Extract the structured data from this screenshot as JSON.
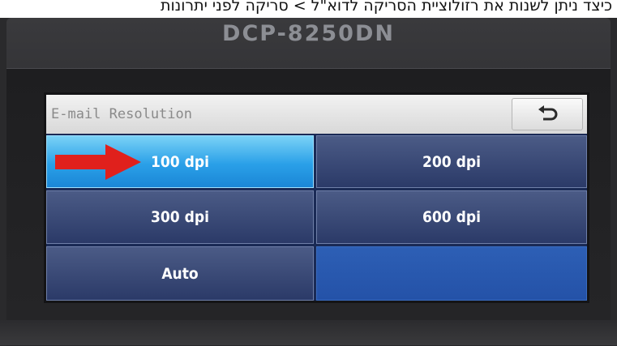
{
  "caption": {
    "text": "כיצד ניתן לשנות את רזולוציית הסריקה לדוא\"ל > סריקה לפני יתרונות"
  },
  "device": {
    "model": "DCP-8250DN"
  },
  "screen": {
    "title": "E-mail Resolution",
    "back_icon": "back-arrow-icon",
    "options": [
      {
        "label": "100 dpi",
        "selected": true
      },
      {
        "label": "200 dpi",
        "selected": false
      },
      {
        "label": "300 dpi",
        "selected": false
      },
      {
        "label": "600 dpi",
        "selected": false
      },
      {
        "label": "Auto",
        "selected": false
      }
    ]
  },
  "colors": {
    "selected": "#2aa0e8",
    "button": "#2b3a68",
    "pointer_arrow": "#e0201c"
  }
}
